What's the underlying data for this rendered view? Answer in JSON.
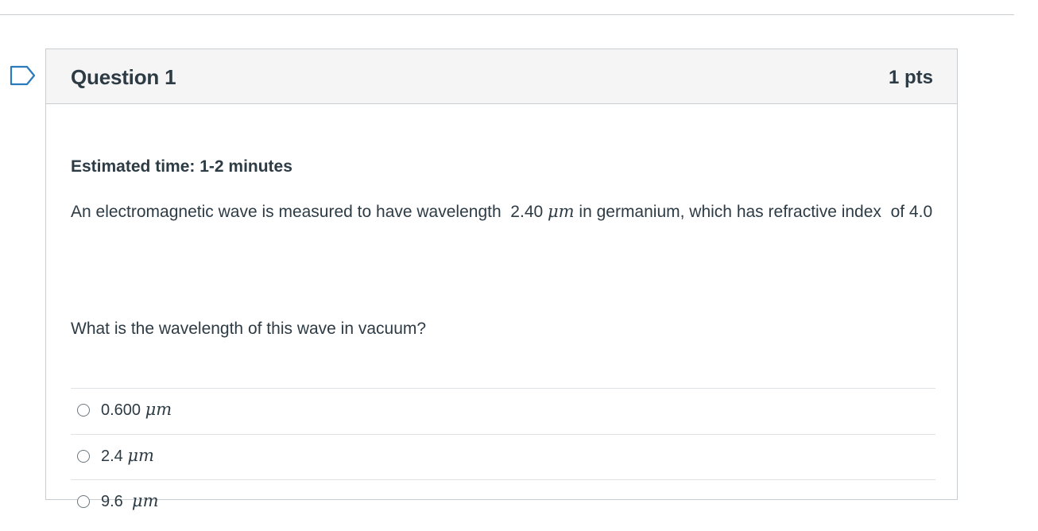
{
  "question": {
    "title": "Question 1",
    "points": "1 pts",
    "estimated_time": "Estimated time: 1-2 minutes",
    "text_part1": "An electromagnetic wave is measured to have wavelength  2.40 ",
    "text_unit": "μm",
    "text_part2": " in germanium, which has refractive index  of 4.0",
    "prompt": "What is the wavelength of this wave in vacuum?"
  },
  "answers": [
    {
      "value": "0.600 ",
      "unit": "μm"
    },
    {
      "value": "2.4 ",
      "unit": "μm"
    },
    {
      "value": "9.6  ",
      "unit": "μm"
    }
  ],
  "icons": {
    "flag": "flag-outline-icon",
    "radio": "radio-unselected-icon"
  },
  "colors": {
    "text": "#2d3b45",
    "header_bg": "#f5f5f5",
    "border": "#c7cdd1",
    "flag": "#2b7abc"
  }
}
